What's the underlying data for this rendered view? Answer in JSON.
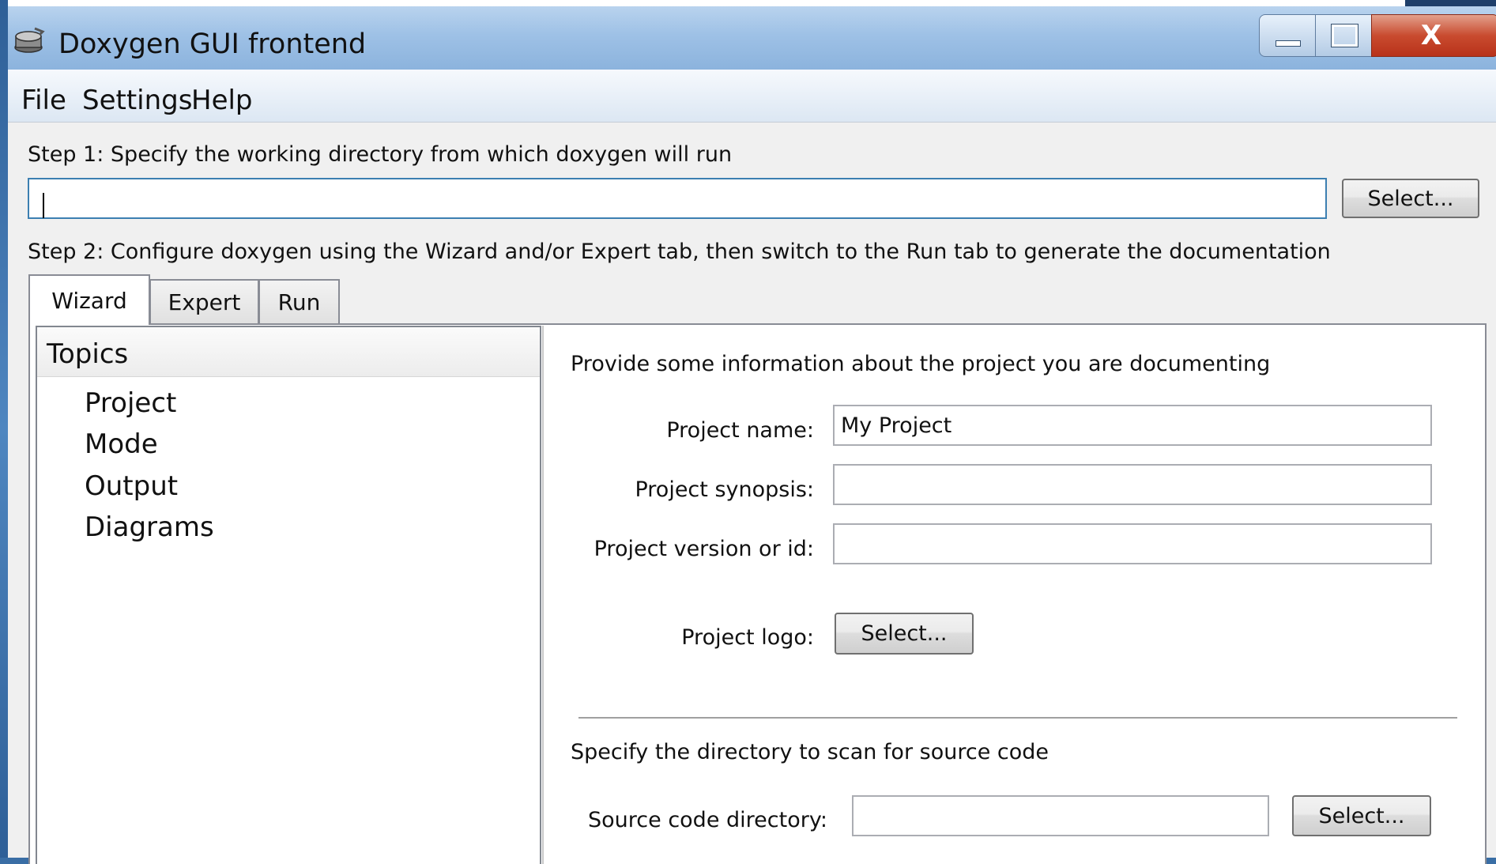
{
  "window": {
    "title": "Doxygen GUI frontend",
    "app_icon": "doxygen-app-icon",
    "controls": {
      "minimize_icon": "minimize-icon",
      "maximize_icon": "maximize-icon",
      "close_icon": "close-icon",
      "close_glyph": "X"
    }
  },
  "menu": {
    "items": [
      "File",
      "Settings",
      "Help"
    ]
  },
  "step1": {
    "label": "Step 1: Specify the working directory from which doxygen will run",
    "directory_value": "",
    "select_label": "Select..."
  },
  "step2": {
    "label": "Step 2: Configure doxygen using the Wizard and/or Expert tab, then switch to the Run tab to generate the documentation"
  },
  "tabs": [
    {
      "label": "Wizard",
      "active": true
    },
    {
      "label": "Expert",
      "active": false
    },
    {
      "label": "Run",
      "active": false
    }
  ],
  "topics": {
    "header": "Topics",
    "items": [
      "Project",
      "Mode",
      "Output",
      "Diagrams"
    ]
  },
  "project": {
    "heading": "Provide some information about the project you are documenting",
    "name_label": "Project name:",
    "name_value": "My Project",
    "synopsis_label": "Project synopsis:",
    "synopsis_value": "",
    "version_label": "Project version or id:",
    "version_value": "",
    "logo_label": "Project logo:",
    "logo_select_label": "Select..."
  },
  "source": {
    "heading": "Specify the directory to scan for source code",
    "dir_label": "Source code directory:",
    "dir_value": "",
    "select_label": "Select..."
  },
  "colors": {
    "titlebar": "#9ec1e6",
    "close_button": "#c94b2f",
    "window_bg": "#f0f0f0",
    "focus_border": "#3c7fb1"
  }
}
